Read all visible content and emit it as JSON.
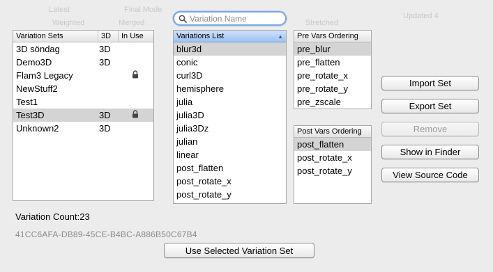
{
  "background_ghost": [
    "Latest",
    "Final Mode",
    "Weighted",
    "Merged",
    "Stretched",
    "Updated 4"
  ],
  "search": {
    "placeholder": "Variation Name"
  },
  "variation_sets": {
    "headers": [
      "Variation Sets",
      "3D",
      "In Use"
    ],
    "rows": [
      {
        "name": "3D söndag",
        "three_d": "3D",
        "locked": false
      },
      {
        "name": "Demo3D",
        "three_d": "3D",
        "locked": false
      },
      {
        "name": "Flam3 Legacy",
        "three_d": "",
        "locked": true
      },
      {
        "name": "NewStuff2",
        "three_d": "",
        "locked": false
      },
      {
        "name": "Test1",
        "three_d": "",
        "locked": false
      },
      {
        "name": "Test3D",
        "three_d": "3D",
        "locked": true,
        "selected": true
      },
      {
        "name": "Unknown2",
        "three_d": "3D",
        "locked": false
      }
    ]
  },
  "variations_list": {
    "header": "Variations List",
    "sort_indicator": "▲",
    "items": [
      "blur3d",
      "conic",
      "curl3D",
      "hemisphere",
      "julia",
      "julia3D",
      "julia3Dz",
      "julian",
      "linear",
      "post_flatten",
      "post_rotate_x",
      "post_rotate_y"
    ],
    "selected_index": 0
  },
  "pre_vars": {
    "header": "Pre Vars Ordering",
    "items": [
      "pre_blur",
      "pre_flatten",
      "pre_rotate_x",
      "pre_rotate_y",
      "pre_zscale"
    ],
    "selected_index": 0
  },
  "post_vars": {
    "header": "Post Vars Ordering",
    "items": [
      "post_flatten",
      "post_rotate_x",
      "post_rotate_y"
    ],
    "selected_index": 0
  },
  "buttons": {
    "import": "Import Set",
    "export": "Export Set",
    "remove": "Remove",
    "show_finder": "Show in Finder",
    "view_source": "View Source Code",
    "use_selected": "Use Selected Variation Set"
  },
  "footer": {
    "count_label": "Variation Count:23",
    "uuid": "41CC6AFA-DB89-45CE-B4BC-A886B50C67B4"
  },
  "colors": {
    "window_bg": "#ececec",
    "selection": "#d4d4d4",
    "header_selected": "#9cc2f1",
    "focus_ring": "#7ea6de"
  }
}
